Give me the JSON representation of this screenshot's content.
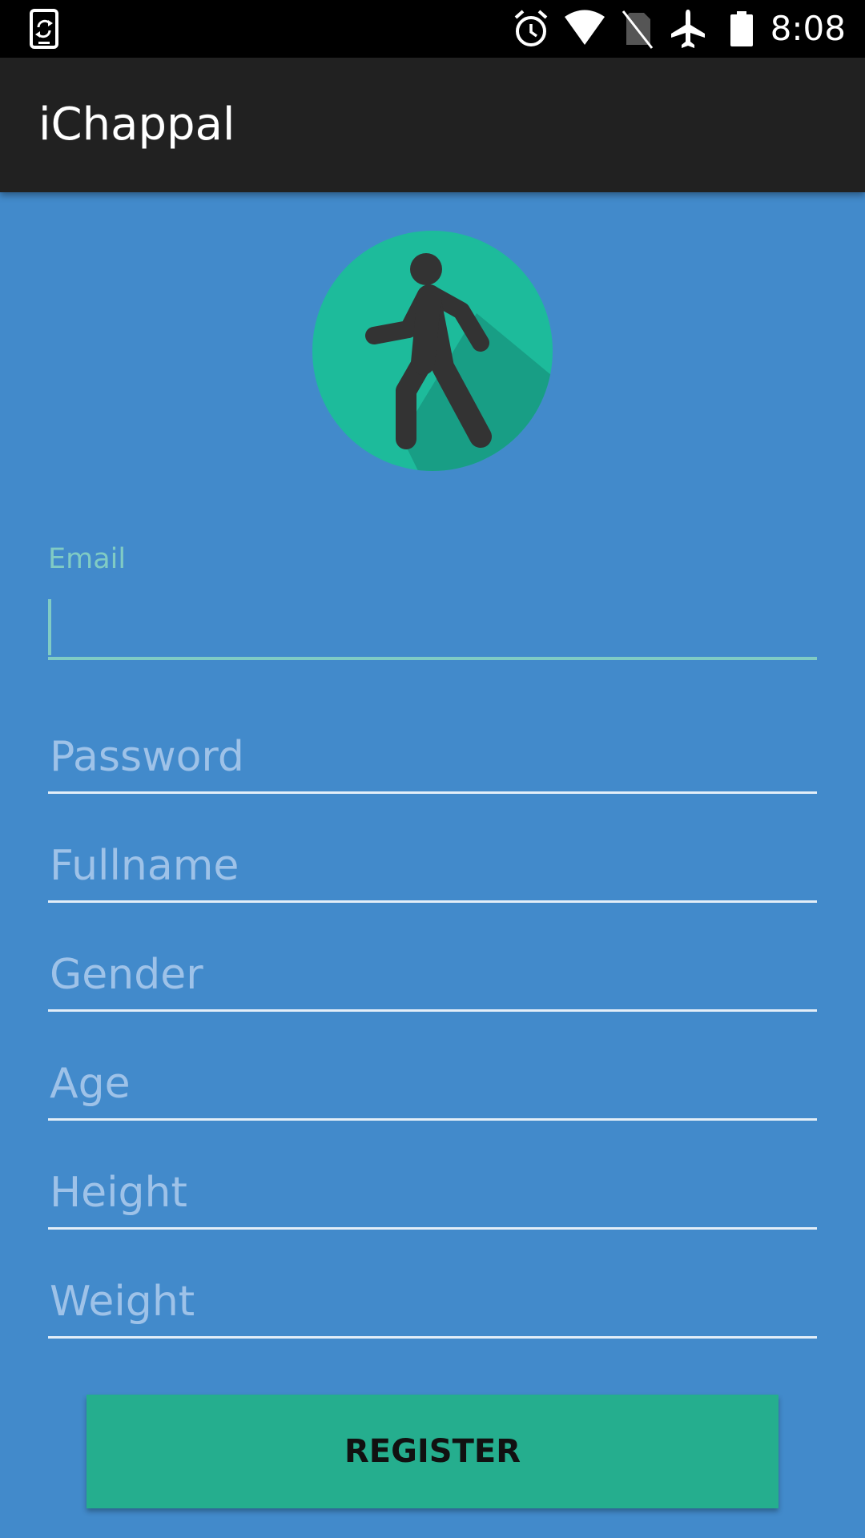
{
  "status_bar": {
    "time": "8:08",
    "icons": [
      "phone-sync-icon",
      "alarm-icon",
      "wifi-icon",
      "no-sim-icon",
      "airplane-icon",
      "battery-icon"
    ]
  },
  "app": {
    "title": "iChappal"
  },
  "logo": {
    "icon": "walking-person-icon",
    "circle_color": "#1DBB9B",
    "shadow_color": "#189E85",
    "figure_color": "#333333"
  },
  "form": {
    "email_label": "Email",
    "email_value": "",
    "fields": [
      {
        "key": "password",
        "placeholder": "Password",
        "value": ""
      },
      {
        "key": "fullname",
        "placeholder": "Fullname",
        "value": ""
      },
      {
        "key": "gender",
        "placeholder": "Gender",
        "value": ""
      },
      {
        "key": "age",
        "placeholder": "Age",
        "value": ""
      },
      {
        "key": "height",
        "placeholder": "Height",
        "value": ""
      },
      {
        "key": "weight",
        "placeholder": "Weight",
        "value": ""
      }
    ],
    "register_label": "REGISTER"
  },
  "colors": {
    "background": "#428ACB",
    "app_bar": "#212121",
    "accent": "#80CBC4",
    "hint_text": "#9EC2E8",
    "underline": "#E3EEF8",
    "button": "#25AE8E"
  }
}
